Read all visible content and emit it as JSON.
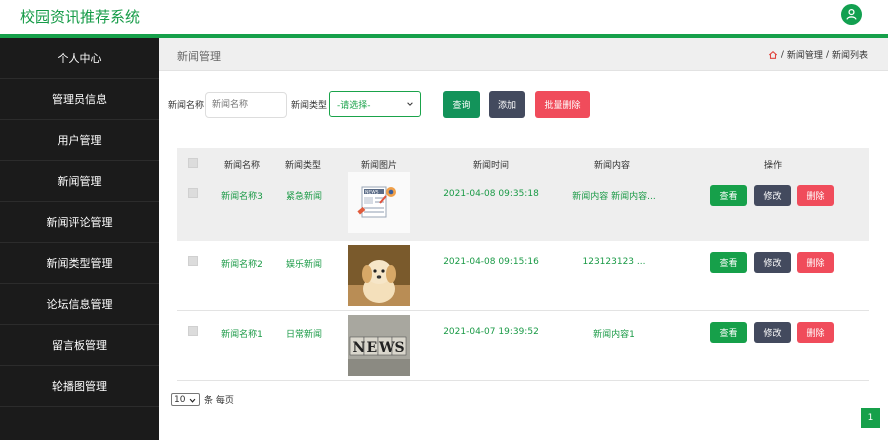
{
  "app": {
    "title": "校园资讯推荐系统"
  },
  "sidebar": {
    "items": [
      {
        "label": "个人中心"
      },
      {
        "label": "管理员信息"
      },
      {
        "label": "用户管理"
      },
      {
        "label": "新闻管理"
      },
      {
        "label": "新闻评论管理"
      },
      {
        "label": "新闻类型管理"
      },
      {
        "label": "论坛信息管理"
      },
      {
        "label": "留言板管理"
      },
      {
        "label": "轮播图管理"
      }
    ]
  },
  "header": {
    "title": "新闻管理",
    "breadcrumb": [
      "新闻管理",
      "新闻列表"
    ],
    "separator": "/"
  },
  "search": {
    "name_label": "新闻名称",
    "name_placeholder": "新闻名称",
    "type_label": "新闻类型",
    "type_selected": "-请选择-",
    "query_label": "查询",
    "add_label": "添加",
    "batch_delete_label": "批量删除"
  },
  "table": {
    "columns": [
      "新闻名称",
      "新闻类型",
      "新闻图片",
      "新闻时间",
      "新闻内容",
      "操作"
    ],
    "rows": [
      {
        "name": "新闻名称3",
        "type": "紧急新闻",
        "image": "news-illustration-icon",
        "time": "2021-04-08 09:35:18",
        "content": "新闻内容 新闻内容..."
      },
      {
        "name": "新闻名称2",
        "type": "娱乐新闻",
        "image": "puppy-photo",
        "time": "2021-04-08 09:15:16",
        "content": "123123123 ..."
      },
      {
        "name": "新闻名称1",
        "type": "日常新闻",
        "image": "news-blocks-photo",
        "time": "2021-04-07 19:39:52",
        "content": "新闻内容1"
      }
    ],
    "actions": {
      "view": "查看",
      "edit": "修改",
      "delete": "删除"
    }
  },
  "pagination": {
    "page_size": "10",
    "per_page_label": "条 每页",
    "current_page": "1"
  },
  "colors": {
    "accent": "#16a04a",
    "sidebar_bg": "#1b1b1b",
    "danger": "#f04c5b",
    "dark_button": "#434a5e"
  }
}
